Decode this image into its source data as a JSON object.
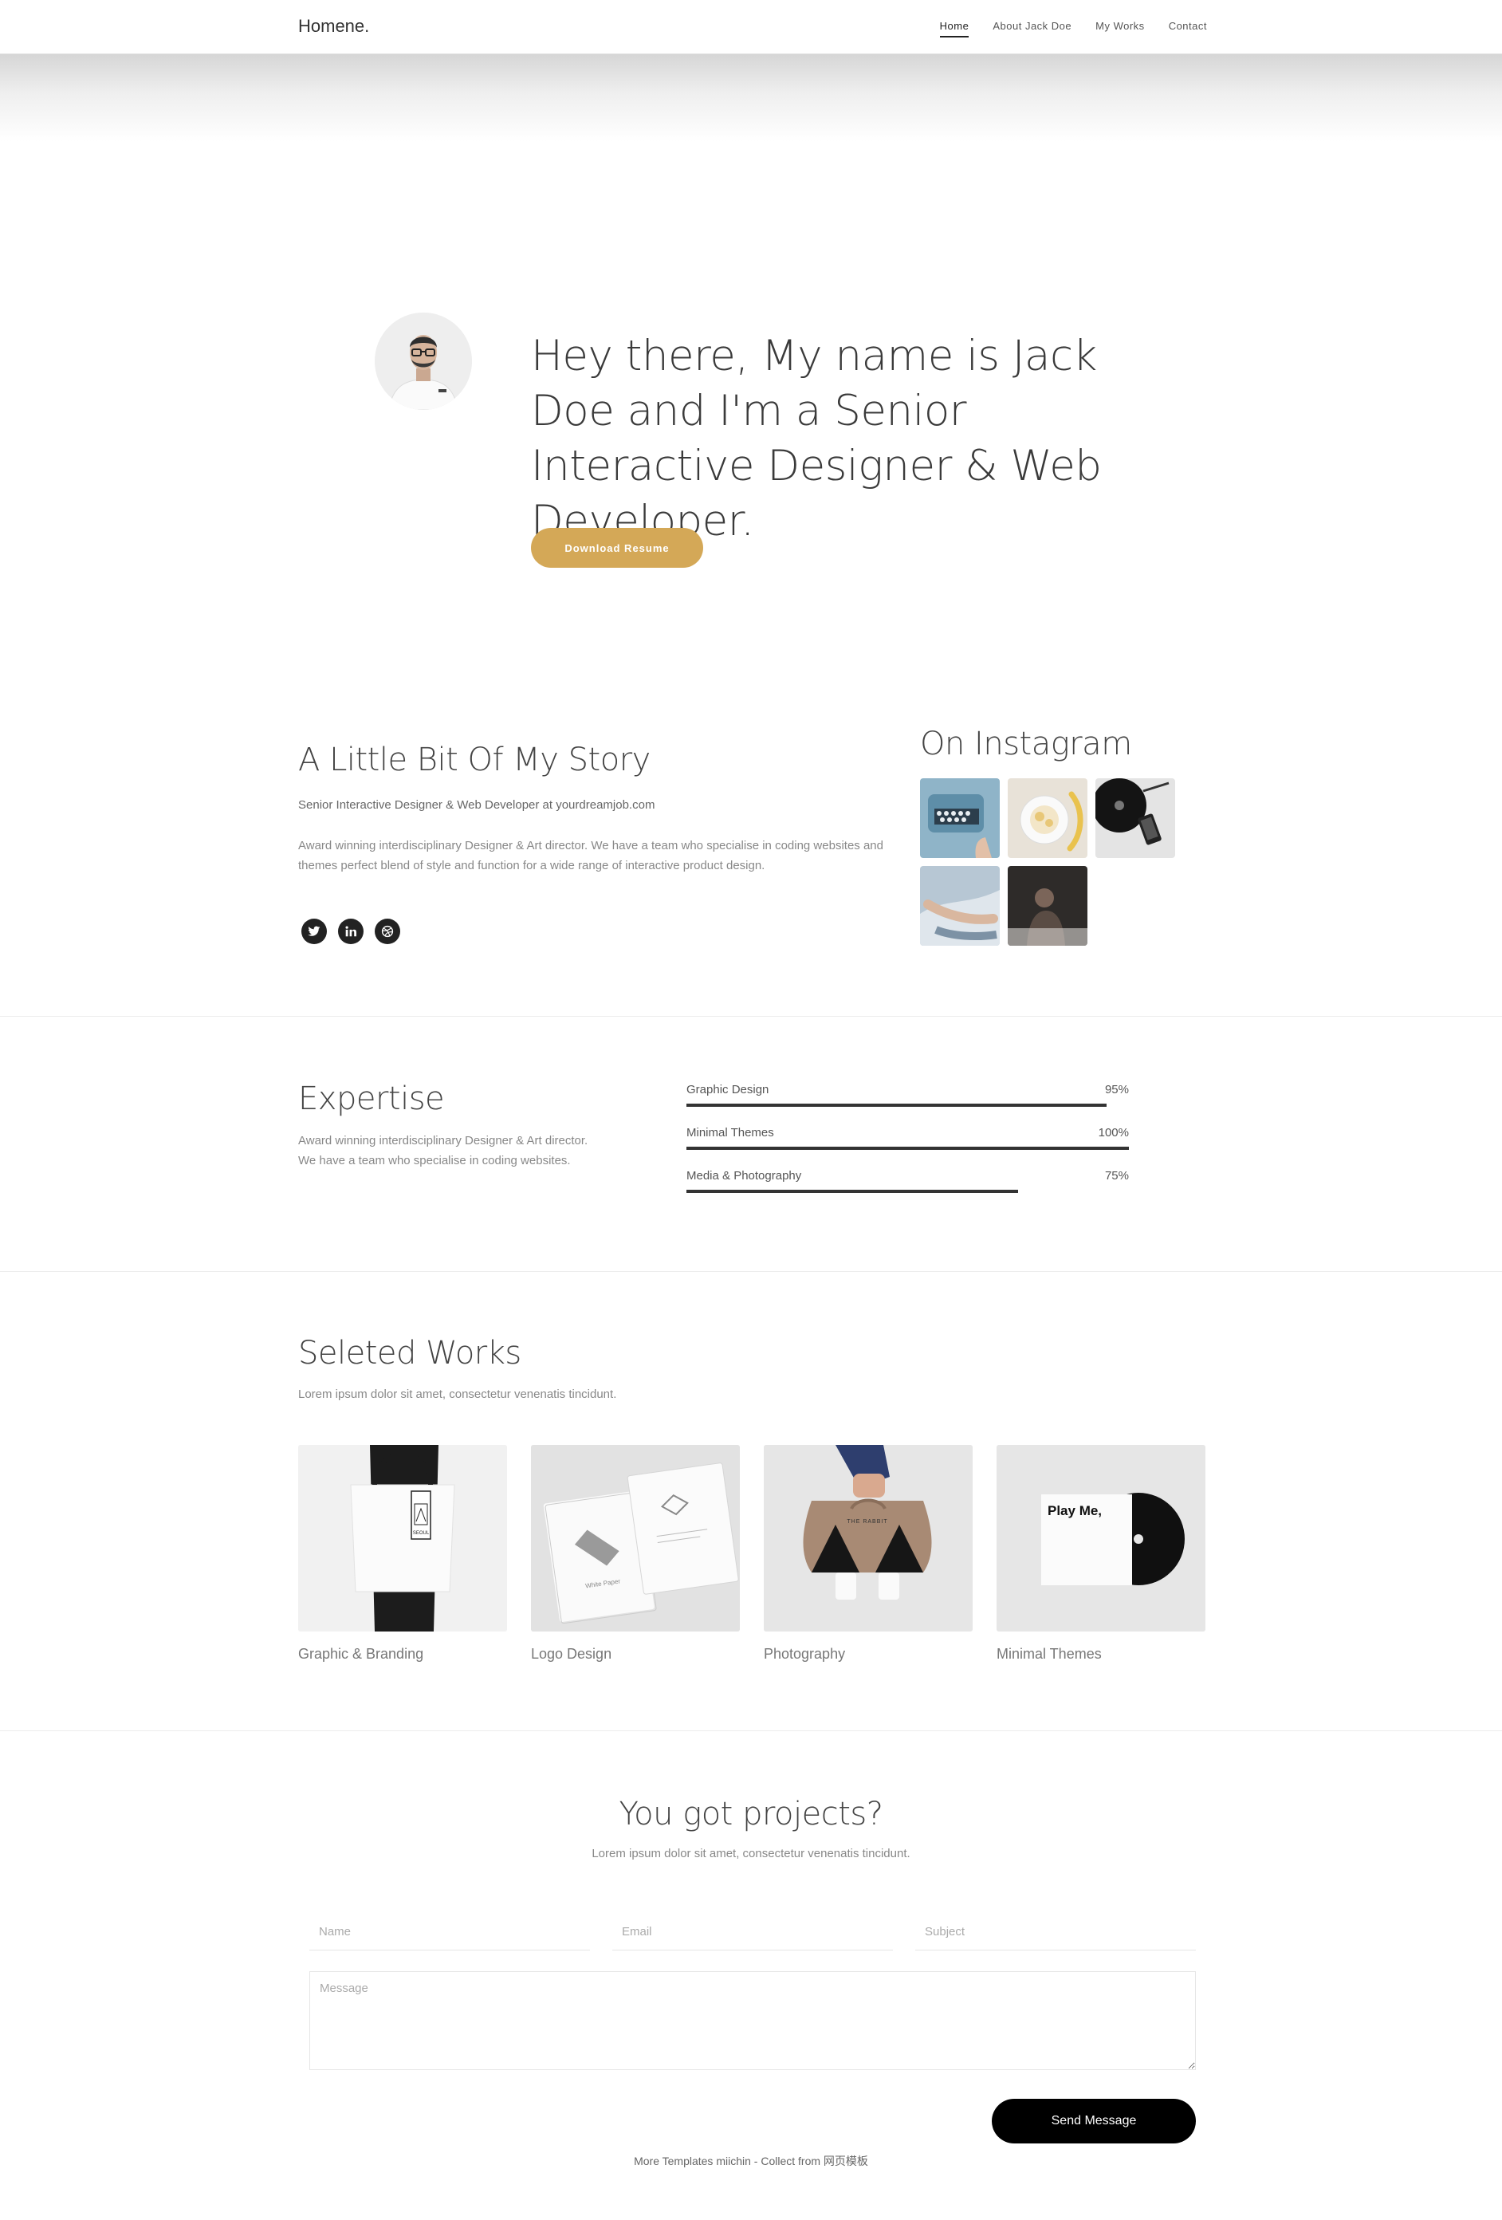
{
  "nav": {
    "brand": "Homene.",
    "items": [
      {
        "label": "Home",
        "active": true
      },
      {
        "label": "About Jack Doe",
        "active": false
      },
      {
        "label": "My Works",
        "active": false
      },
      {
        "label": "Contact",
        "active": false
      }
    ]
  },
  "hero": {
    "title": "Hey there, My name is Jack Doe and I'm a Senior Interactive Designer & Web Developer.",
    "button_label": "Download Resume"
  },
  "story": {
    "title": "A Little Bit Of My Story",
    "subtitle": "Senior Interactive Designer & Web Developer at yourdreamjob.com",
    "text": "Award winning interdisciplinary Designer & Art director. We have a team who specialise in coding websites and themes perfect blend of style and function for a wide range of interactive product design.",
    "socials": [
      "twitter-icon",
      "linkedin-icon",
      "dribbble-icon"
    ]
  },
  "instagram": {
    "title": "On Instagram",
    "photos": [
      "typewriter-photo",
      "breakfast-photo",
      "vinyl-phone-photo",
      "lying-person-photo",
      "dark-portrait-photo"
    ]
  },
  "expertise": {
    "title": "Expertise",
    "text": "Award winning interdisciplinary Designer & Art director. We have a team who specialise in coding websites.",
    "skills": [
      {
        "name": "Graphic Design",
        "value": "95%",
        "level": 95
      },
      {
        "name": "Minimal Themes",
        "value": "100%",
        "level": 100
      },
      {
        "name": "Media & Photography",
        "value": "75%",
        "level": 75
      }
    ]
  },
  "works": {
    "title": "Seleted Works",
    "subtitle": "Lorem ipsum dolor sit amet, consectetur venenatis tincidunt.",
    "items": [
      {
        "label": "Graphic & Branding",
        "image": "tote-bag-mockup",
        "tag_text": "SEOUL"
      },
      {
        "label": "Logo Design",
        "image": "business-cards-mockup",
        "card_text": "White Paper"
      },
      {
        "label": "Photography",
        "image": "cup-carrier-mockup",
        "brand_text": "THE RABBIT"
      },
      {
        "label": "Minimal Themes",
        "image": "vinyl-record-mockup",
        "cover_text": "Play Me,"
      }
    ]
  },
  "contact": {
    "title": "You got projects?",
    "subtitle": "Lorem ipsum dolor sit amet, consectetur venenatis tincidunt.",
    "name_placeholder": "Name",
    "email_placeholder": "Email",
    "subject_placeholder": "Subject",
    "message_placeholder": "Message",
    "send_label": "Send Message"
  },
  "footer": {
    "text": "More Templates miichin - Collect from 网页模板"
  },
  "colors": {
    "accent": "#d4a857",
    "dark": "#222222",
    "send_button": "#000000"
  }
}
